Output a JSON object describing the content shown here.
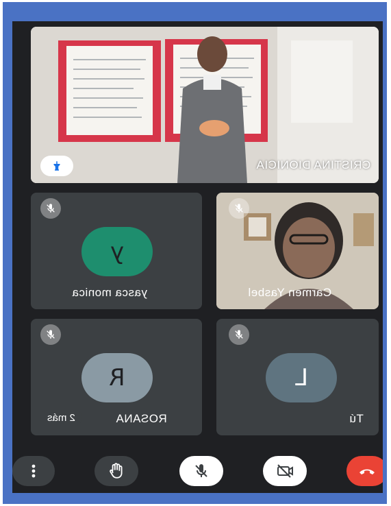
{
  "main_tile": {
    "participant_name": "CRISTINA DIONICIA",
    "pin_icon": "pin-icon"
  },
  "tiles": [
    {
      "participant_name": "yasca monica",
      "avatar_letter": "y",
      "muted": true
    },
    {
      "participant_name": "Carmen Yasbel",
      "muted": true
    },
    {
      "participant_name": "ROSANA",
      "avatar_letter": "R",
      "muted": true,
      "more_label": "2 más"
    },
    {
      "participant_name": "Tú",
      "avatar_letter": "L",
      "muted": true
    }
  ],
  "controls": {
    "more": "more-vert-icon",
    "raise_hand": "hand-icon",
    "mic": "mic-off-icon",
    "camera": "camera-off-icon",
    "hangup": "hangup-icon"
  },
  "colors": {
    "frame_blue": "#4a72c4",
    "tile": "#3c4043",
    "avatar_green": "#1e8e6e",
    "avatar_slate": "#5f7480",
    "avatar_gray": "#8a9aa4",
    "hangup_red": "#ea4335"
  }
}
